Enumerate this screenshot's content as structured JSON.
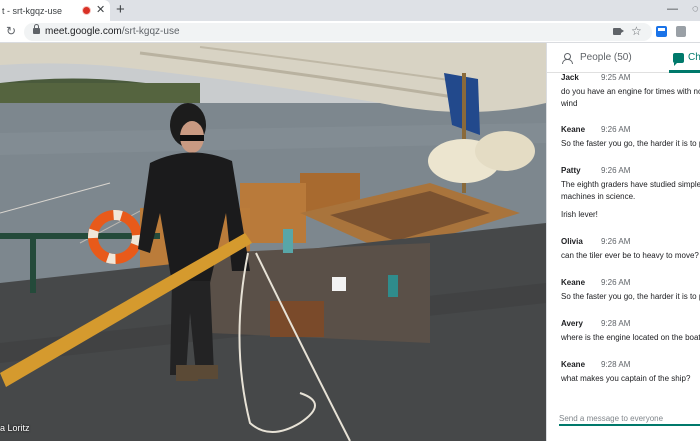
{
  "browser": {
    "tab_title": "t - srt-kgqz-use",
    "tab_close": "✕",
    "new_tab": "+",
    "window_min": "—",
    "window_partial": "◌",
    "url_host": "meet.google.com",
    "url_path": "/srt-kgqz-use",
    "reload": "↻",
    "star": "☆"
  },
  "video": {
    "participant_name": "a Loritz"
  },
  "panel": {
    "people_label": "People (50)",
    "chat_label": "Chat",
    "messages": [
      {
        "sender": "Jack",
        "time": "9:25 AM",
        "lines": [
          "do you have an engine for times with no",
          "wind"
        ]
      },
      {
        "sender": "Keane",
        "time": "9:26 AM",
        "lines": [
          "So the faster you go, the harder it is to push"
        ]
      },
      {
        "sender": "Patty",
        "time": "9:26 AM",
        "lines": [
          "The eighth graders have studied simple",
          "machines in science.",
          "Irish lever!"
        ]
      },
      {
        "sender": "Olivia",
        "time": "9:26 AM",
        "lines": [
          "can the tiler ever be to heavy to move?"
        ]
      },
      {
        "sender": "Keane",
        "time": "9:26 AM",
        "lines": [
          "So the faster you go, the harder it is to push"
        ]
      },
      {
        "sender": "Avery",
        "time": "9:28 AM",
        "lines": [
          "where is the engine located on the boat?"
        ]
      },
      {
        "sender": "Keane",
        "time": "9:28 AM",
        "lines": [
          "what makes you captain of the ship?"
        ]
      }
    ],
    "input_placeholder": "Send a message to everyone"
  },
  "colors": {
    "accent": "#00796b",
    "recording": "#d93025",
    "tab_strip": "#dee1e6"
  }
}
